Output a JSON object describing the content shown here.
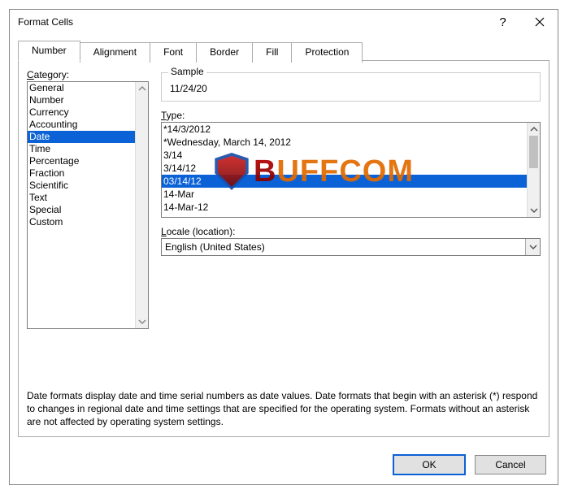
{
  "dialog": {
    "title": "Format Cells"
  },
  "tabs": {
    "number": "Number",
    "alignment": "Alignment",
    "font": "Font",
    "border": "Border",
    "fill": "Fill",
    "protection": "Protection"
  },
  "category": {
    "label": "Category:",
    "items": [
      "General",
      "Number",
      "Currency",
      "Accounting",
      "Date",
      "Time",
      "Percentage",
      "Fraction",
      "Scientific",
      "Text",
      "Special",
      "Custom"
    ],
    "selected_index": 4
  },
  "sample": {
    "label": "Sample",
    "value": "11/24/20"
  },
  "type": {
    "label": "Type:",
    "items": [
      "*14/3/2012",
      "*Wednesday, March 14, 2012",
      "3/14",
      "3/14/12",
      "03/14/12",
      "14-Mar",
      "14-Mar-12"
    ],
    "selected_index": 4
  },
  "locale": {
    "label": "Locale (location):",
    "value": "English (United States)"
  },
  "description": "Date formats display date and time serial numbers as date values.  Date formats that begin with an asterisk (*) respond to changes in regional date and time settings that are specified for the operating system. Formats without an asterisk are not affected by operating system settings.",
  "buttons": {
    "ok": "OK",
    "cancel": "Cancel"
  },
  "watermark": {
    "text_b": "B",
    "text_uff": "UFF",
    "text_com": "COM"
  }
}
